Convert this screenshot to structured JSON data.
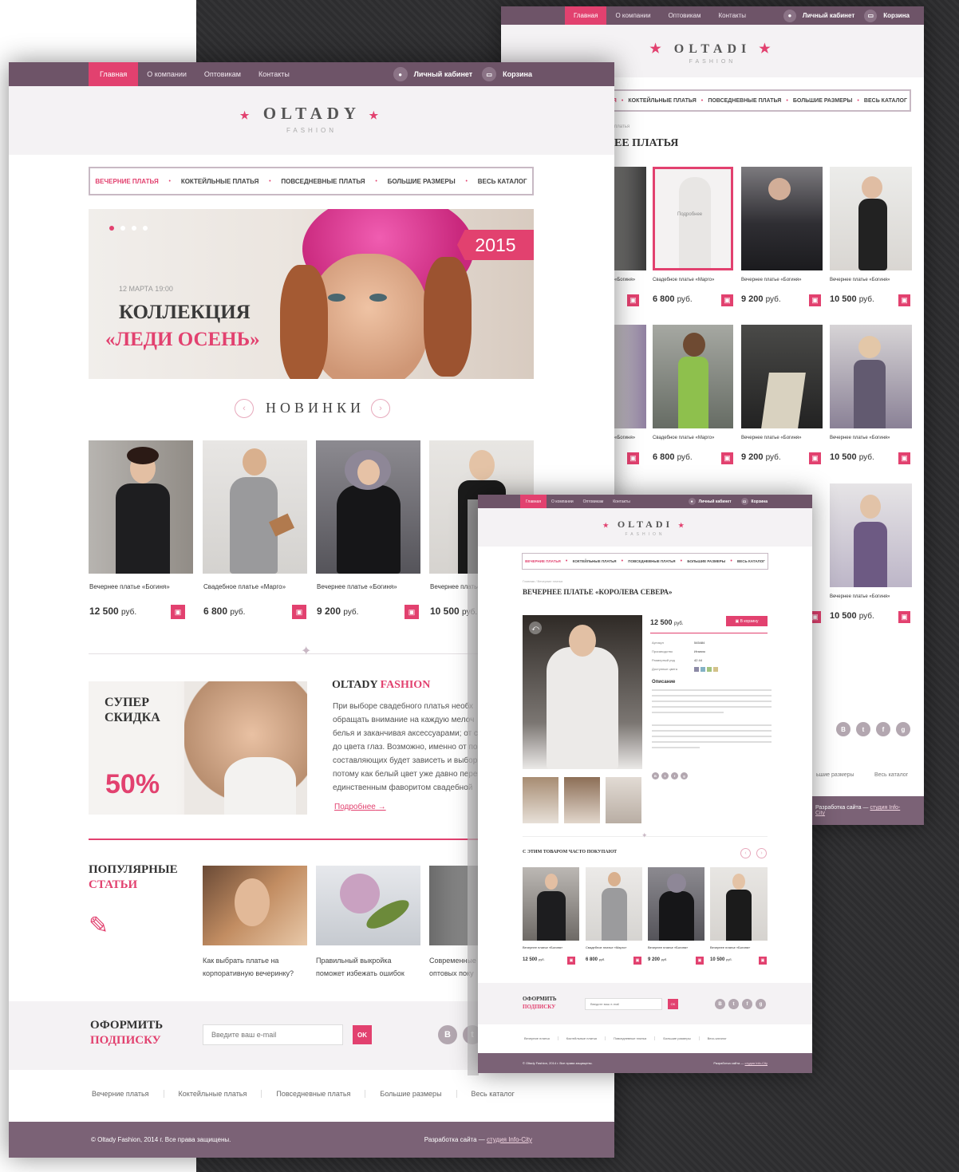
{
  "brand": {
    "logo": "OLTADY",
    "logo_b": "OLTADI",
    "sub": "FASHION"
  },
  "nav": {
    "items": [
      "Главная",
      "О компании",
      "Оптовикам",
      "Контакты"
    ],
    "account": "Личный кабинет",
    "cart": "Корзина"
  },
  "categories": [
    "ВЕЧЕРНИЕ ПЛАТЬЯ",
    "КОКТЕЙЛЬНЫЕ ПЛАТЬЯ",
    "ПОВСЕДНЕВНЫЕ ПЛАТЬЯ",
    "БОЛЬШИЕ РАЗМЕРЫ",
    "ВЕСЬ КАТАЛОГ"
  ],
  "hero": {
    "badge": "2015",
    "date": "12 МАРТА 19:00",
    "title1": "КОЛЛЕКЦИЯ",
    "title2": "«ЛЕДИ ОСЕНЬ»"
  },
  "new_title": "НОВИНКИ",
  "products": [
    {
      "name": "Вечернее платье «Богиня»",
      "price": "12 500",
      "cur": "руб."
    },
    {
      "name": "Свадебное платье «Марго»",
      "price": "6 800",
      "cur": "руб."
    },
    {
      "name": "Вечернее платье «Богиня»",
      "price": "9 200",
      "cur": "руб."
    },
    {
      "name": "Вечернее платье «Богиня»",
      "price": "10 500",
      "cur": "руб."
    }
  ],
  "sale": {
    "l1": "СУПЕР",
    "l2": "СКИДКА",
    "pct": "50%"
  },
  "about": {
    "t1": "OLTADY",
    "t2": "FASHION",
    "lines": [
      "При выборе свадебного платья необх",
      "обращать внимание на каждую мелоч",
      "белья и заканчивая аксессуарами; от с",
      "до цвета глаз. Возможно, именно от по",
      "составляющих будет зависеть и выбор",
      "потому как белый цвет уже давно пере",
      "единственным фаворитом свадебной"
    ],
    "more": "Подробнее"
  },
  "popular": {
    "t1": "ПОПУЛЯРНЫЕ",
    "t2": "СТАТЬИ",
    "a1": [
      "Как выбрать платье на",
      "корпоративную вечеринку?"
    ],
    "a2": [
      "Правильный выкройка",
      "поможет избежать ошибок"
    ],
    "a3": [
      "Современные",
      "оптовых поку"
    ]
  },
  "subscribe": {
    "t1": "ОФОРМИТЬ",
    "t2": "ПОДПИСКУ",
    "placeholder": "Введите ваш e-mail",
    "ok": "OK"
  },
  "social": [
    "В",
    "t",
    "f",
    "g"
  ],
  "footer_links": [
    "Вечерние платья",
    "Коктейльные платья",
    "Повседневные платья",
    "Большие размеры",
    "Весь каталог"
  ],
  "copyright": "© Oltady Fashion, 2014 г. Все права защищены.",
  "dev": {
    "label": "Разработка сайта —",
    "link": "студия Info-City"
  },
  "catalog": {
    "title": "ЕЕ ПЛАТЬЯ",
    "crumb": "платья",
    "sel": "Подробнее",
    "n": [
      "Вечернее платье «Богиня»",
      "Свадебное платье «Марго»",
      "Вечернее платье «Богиня»",
      "Вечернее платье «Богиня»"
    ],
    "p": [
      "6 800",
      "9 200",
      "10 500"
    ],
    "frag": "«Богиня»",
    "frag2": "ьшие размеры",
    "cats": [
      "ЬЯ",
      "КОКТЕЙЛЬНЫЕ ПЛАТЬЯ",
      "ПОВСЕДНЕВНЫЕ ПЛАТЬЯ",
      "БОЛЬШИЕ РАЗМЕРЫ",
      "ВЕСЬ КАТАЛОГ"
    ]
  },
  "detail": {
    "crumb": "Главная / Вечерние платья",
    "title": "ВЕЧЕРНЕЕ ПЛАТЬЕ «КОРОЛЕВА СЕВЕРА»",
    "price": "12 500",
    "add": "В корзину",
    "desc": "Описание",
    "specs": [
      "Артикул",
      "Производство",
      "Размерный ряд",
      "Доступные цвета"
    ],
    "vals": [
      "545484",
      "Италия",
      "42  44",
      ""
    ],
    "also": "С ЭТИМ ТОВАРОМ ЧАСТО ПОКУПАЮТ",
    "pn": [
      "Вечернее платье «Богиня»",
      "Свадебное платье «Марго»",
      "Вечернее платье «Богиня»",
      "Вечернее платье «Богиня»"
    ]
  },
  "colors": {
    "accent": "#e2416f",
    "nav": "#6e5468",
    "footer": "#7b6276"
  }
}
